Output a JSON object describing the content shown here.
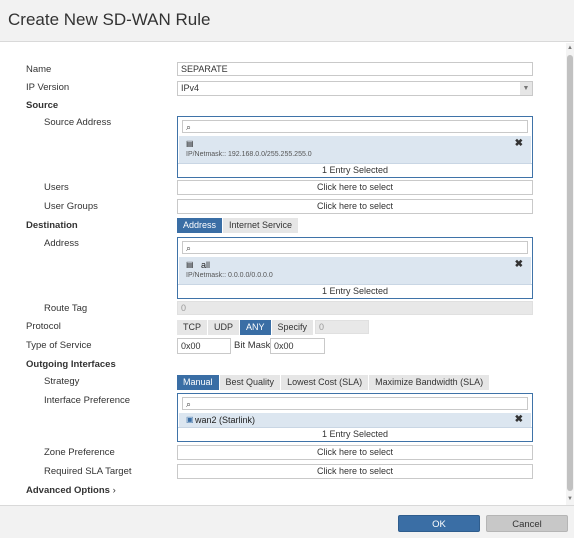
{
  "dialog": {
    "title": "Create New SD-WAN Rule"
  },
  "labels": {
    "name": "Name",
    "ip_version": "IP Version",
    "source": "Source",
    "source_address": "Source Address",
    "users": "Users",
    "user_groups": "User Groups",
    "destination": "Destination",
    "address": "Address",
    "route_tag": "Route Tag",
    "protocol": "Protocol",
    "type_of_service": "Type of Service",
    "bit_mask": "Bit Mask",
    "outgoing_interfaces": "Outgoing Interfaces",
    "strategy": "Strategy",
    "interface_preference": "Interface Preference",
    "zone_preference": "Zone Preference",
    "required_sla_target": "Required SLA Target",
    "advanced_options": "Advanced Options"
  },
  "fields": {
    "name": "SEPARATE",
    "ip_version": "IPv4",
    "route_tag": "0",
    "protocol_number": "0",
    "tos_value": "0x00",
    "bit_mask_value": "0x00"
  },
  "placeholders": {
    "click_to_select": "Click here to select"
  },
  "source_picker": {
    "entry_name": "",
    "entry_sub": "IP/Netmask:: 192.168.0.0/255.255.255.0",
    "count": "1 Entry Selected"
  },
  "destination_tabs": [
    "Address",
    "Internet Service"
  ],
  "destination_picker": {
    "entry_name": "all",
    "entry_sub": "IP/Netmask:: 0.0.0.0/0.0.0.0",
    "count": "1 Entry Selected"
  },
  "protocol_options": [
    "TCP",
    "UDP",
    "ANY",
    "Specify"
  ],
  "protocol_active": "ANY",
  "strategy_options": [
    "Manual",
    "Best Quality",
    "Lowest Cost (SLA)",
    "Maximize Bandwidth (SLA)"
  ],
  "strategy_active": "Manual",
  "interface_picker": {
    "entry_name": "wan2 (Starlink)",
    "count": "1 Entry Selected"
  },
  "footer": {
    "ok": "OK",
    "cancel": "Cancel"
  },
  "colors": {
    "accent": "#3a6ea5",
    "selected_bg": "#dce6f0",
    "border_active": "#3f73a8"
  }
}
